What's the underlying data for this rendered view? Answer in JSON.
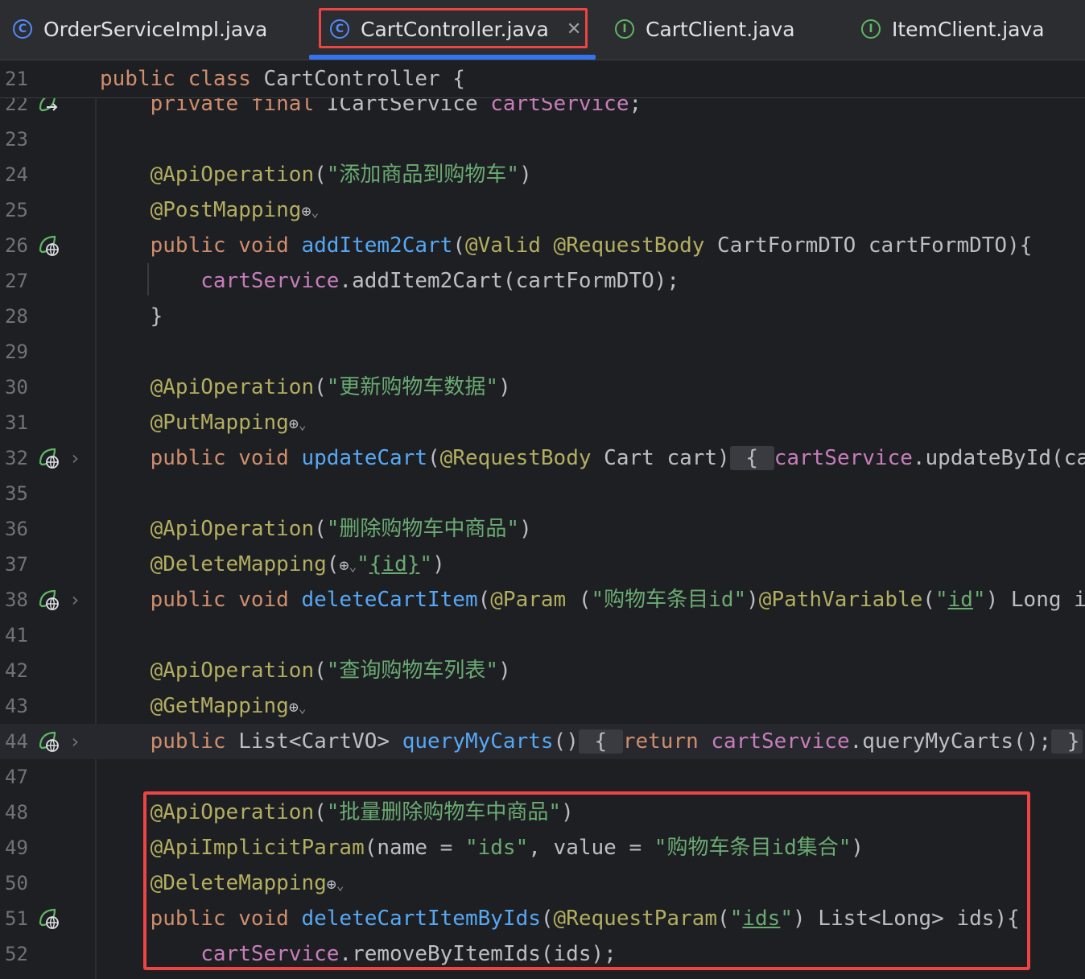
{
  "tabs": [
    {
      "name": "OrderServiceImpl.java",
      "icon": "class-icon",
      "glyph": "C",
      "active": false
    },
    {
      "name": "CartController.java",
      "icon": "class-icon",
      "glyph": "C",
      "active": true
    },
    {
      "name": "CartClient.java",
      "icon": "interface-icon",
      "glyph": "I",
      "active": false
    },
    {
      "name": "ItemClient.java",
      "icon": "interface-icon",
      "glyph": "I",
      "active": false
    }
  ],
  "close_glyph": "✕",
  "colors": {
    "keyword": "#cf8e6d",
    "annotation": "#b3ae60",
    "string": "#6aab73",
    "method": "#56a8f5",
    "field": "#c77dbb",
    "highlight_box": "#ee4444",
    "active_tab_underline": "#3574f0"
  },
  "sticky_line": {
    "num": "21",
    "tokens": [
      [
        "kw",
        "public class "
      ],
      [
        "pl",
        "CartController {"
      ]
    ]
  },
  "lines": [
    {
      "num": "22",
      "icon": "bean-arrow",
      "tokens": [
        [
          "pl",
          "    "
        ],
        [
          "kw",
          "private final "
        ],
        [
          "pl",
          "ICartService "
        ],
        [
          "fld",
          "cartService"
        ],
        [
          "pl",
          ";"
        ]
      ]
    },
    {
      "num": "23",
      "tokens": []
    },
    {
      "num": "24",
      "tokens": [
        [
          "pl",
          "    "
        ],
        [
          "an",
          "@ApiOperation"
        ],
        [
          "pl",
          "("
        ],
        [
          "str",
          "\"添加商品到购物车\""
        ],
        [
          "pl",
          ")"
        ]
      ]
    },
    {
      "num": "25",
      "tokens": [
        [
          "pl",
          "    "
        ],
        [
          "an",
          "@PostMapping"
        ],
        [
          "globe",
          "⊕"
        ],
        [
          "chev",
          "⌄"
        ]
      ]
    },
    {
      "num": "26",
      "icon": "bean-web",
      "tokens": [
        [
          "pl",
          "    "
        ],
        [
          "kw",
          "public void "
        ],
        [
          "fn",
          "addItem2Cart"
        ],
        [
          "pl",
          "("
        ],
        [
          "an",
          "@Valid @RequestBody "
        ],
        [
          "pl",
          "CartFormDTO cartFormDTO){"
        ]
      ]
    },
    {
      "num": "27",
      "tokens": [
        [
          "pl",
          "        "
        ],
        [
          "fld",
          "cartService"
        ],
        [
          "pl",
          ".addItem2Cart(cartFormDTO);"
        ]
      ]
    },
    {
      "num": "28",
      "tokens": [
        [
          "pl",
          "    }"
        ]
      ]
    },
    {
      "num": "29",
      "tokens": []
    },
    {
      "num": "30",
      "tokens": [
        [
          "pl",
          "    "
        ],
        [
          "an",
          "@ApiOperation"
        ],
        [
          "pl",
          "("
        ],
        [
          "str",
          "\"更新购物车数据\""
        ],
        [
          "pl",
          ")"
        ]
      ]
    },
    {
      "num": "31",
      "tokens": [
        [
          "pl",
          "    "
        ],
        [
          "an",
          "@PutMapping"
        ],
        [
          "globe",
          "⊕"
        ],
        [
          "chev",
          "⌄"
        ]
      ]
    },
    {
      "num": "32",
      "icon": "bean-web",
      "fold": true,
      "tokens": [
        [
          "pl",
          "    "
        ],
        [
          "kw",
          "public void "
        ],
        [
          "fn",
          "updateCart"
        ],
        [
          "pl",
          "("
        ],
        [
          "an",
          "@RequestBody "
        ],
        [
          "pl",
          "Cart cart)"
        ],
        [
          "collapsed",
          " { "
        ],
        [
          "fld",
          "cartService"
        ],
        [
          "pl",
          ".updateById(car"
        ]
      ]
    },
    {
      "num": "35",
      "tokens": []
    },
    {
      "num": "36",
      "tokens": [
        [
          "pl",
          "    "
        ],
        [
          "an",
          "@ApiOperation"
        ],
        [
          "pl",
          "("
        ],
        [
          "str",
          "\"删除购物车中商品\""
        ],
        [
          "pl",
          ")"
        ]
      ]
    },
    {
      "num": "37",
      "tokens": [
        [
          "pl",
          "    "
        ],
        [
          "an",
          "@DeleteMapping"
        ],
        [
          "pl",
          "("
        ],
        [
          "globe",
          "⊕"
        ],
        [
          "chev",
          "⌄"
        ],
        [
          "str",
          "\""
        ],
        [
          "strund",
          "{id}"
        ],
        [
          "str",
          "\""
        ],
        [
          "pl",
          ")"
        ]
      ]
    },
    {
      "num": "38",
      "icon": "bean-web",
      "fold": true,
      "tokens": [
        [
          "pl",
          "    "
        ],
        [
          "kw",
          "public void "
        ],
        [
          "fn",
          "deleteCartItem"
        ],
        [
          "pl",
          "("
        ],
        [
          "an",
          "@Param "
        ],
        [
          "pl",
          "("
        ],
        [
          "str",
          "\"购物车条目id\""
        ],
        [
          "pl",
          ")"
        ],
        [
          "an",
          "@PathVariable"
        ],
        [
          "pl",
          "("
        ],
        [
          "str",
          "\""
        ],
        [
          "strund",
          "id"
        ],
        [
          "str",
          "\""
        ],
        [
          "pl",
          ") Long i"
        ]
      ]
    },
    {
      "num": "41",
      "tokens": []
    },
    {
      "num": "42",
      "tokens": [
        [
          "pl",
          "    "
        ],
        [
          "an",
          "@ApiOperation"
        ],
        [
          "pl",
          "("
        ],
        [
          "str",
          "\"查询购物车列表\""
        ],
        [
          "pl",
          ")"
        ]
      ]
    },
    {
      "num": "43",
      "tokens": [
        [
          "pl",
          "    "
        ],
        [
          "an",
          "@GetMapping"
        ],
        [
          "globe",
          "⊕"
        ],
        [
          "chev",
          "⌄"
        ]
      ]
    },
    {
      "num": "44",
      "icon": "bean-web",
      "fold": true,
      "highlight": true,
      "tokens": [
        [
          "pl",
          "    "
        ],
        [
          "kw",
          "public "
        ],
        [
          "pl",
          "List<CartVO> "
        ],
        [
          "fn",
          "queryMyCarts"
        ],
        [
          "pl",
          "()"
        ],
        [
          "collapsed",
          " { "
        ],
        [
          "kw",
          "return "
        ],
        [
          "fld",
          "cartService"
        ],
        [
          "pl",
          ".queryMyCarts();"
        ],
        [
          "collapsed",
          " }"
        ]
      ]
    },
    {
      "num": "47",
      "tokens": []
    },
    {
      "num": "48",
      "tokens": [
        [
          "pl",
          "    "
        ],
        [
          "an",
          "@ApiOperation"
        ],
        [
          "pl",
          "("
        ],
        [
          "str",
          "\"批量删除购物车中商品\""
        ],
        [
          "pl",
          ")"
        ]
      ]
    },
    {
      "num": "49",
      "tokens": [
        [
          "pl",
          "    "
        ],
        [
          "an",
          "@ApiImplicitParam"
        ],
        [
          "pl",
          "(name = "
        ],
        [
          "str",
          "\"ids\""
        ],
        [
          "pl",
          ", value = "
        ],
        [
          "str",
          "\"购物车条目id集合\""
        ],
        [
          "pl",
          ")"
        ]
      ]
    },
    {
      "num": "50",
      "tokens": [
        [
          "pl",
          "    "
        ],
        [
          "an",
          "@DeleteMapping"
        ],
        [
          "globe",
          "⊕"
        ],
        [
          "chev",
          "⌄"
        ]
      ]
    },
    {
      "num": "51",
      "icon": "bean-web",
      "tokens": [
        [
          "pl",
          "    "
        ],
        [
          "kw",
          "public void "
        ],
        [
          "fn",
          "deleteCartItemByIds"
        ],
        [
          "pl",
          "("
        ],
        [
          "an",
          "@RequestParam"
        ],
        [
          "pl",
          "("
        ],
        [
          "str",
          "\""
        ],
        [
          "strund",
          "ids"
        ],
        [
          "str",
          "\""
        ],
        [
          "pl",
          ") List<Long> ids){"
        ]
      ]
    },
    {
      "num": "52",
      "tokens": [
        [
          "pl",
          "        "
        ],
        [
          "fld",
          "cartService"
        ],
        [
          "pl",
          ".removeByItemIds(ids);"
        ]
      ]
    }
  ]
}
